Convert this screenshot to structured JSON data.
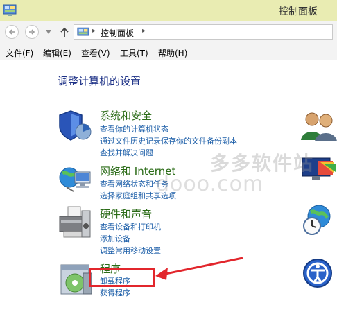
{
  "window": {
    "title": "控制面板"
  },
  "address": {
    "path_label": "控制面板",
    "sep1": "▸",
    "sep2": "▸"
  },
  "menu": {
    "items": [
      "文件(F)",
      "编辑(E)",
      "查看(V)",
      "工具(T)",
      "帮助(H)"
    ]
  },
  "main": {
    "heading": "调整计算机的设置",
    "categories": [
      {
        "title": "系统和安全",
        "links": [
          "查看你的计算机状态",
          "通过文件历史记录保存你的文件备份副本",
          "查找并解决问题"
        ]
      },
      {
        "title": "网络和 Internet",
        "links": [
          "查看网络状态和任务",
          "选择家庭组和共享选项"
        ]
      },
      {
        "title": "硬件和声音",
        "links": [
          "查看设备和打印机",
          "添加设备",
          "调整常用移动设置"
        ]
      },
      {
        "title": "程序",
        "links": [
          "卸载程序",
          "获得程序"
        ]
      }
    ]
  },
  "watermark": {
    "cn": "多多软件站",
    "en": "dooo.com"
  },
  "colors": {
    "title_bg": "#e9ecb2",
    "category_title": "#2a6b16",
    "link": "#1c5ea8",
    "heading": "#1e3287",
    "annotation": "#e2262c"
  },
  "icons": {
    "app": "control-panel-icon",
    "back": "back-arrow-icon",
    "forward": "forward-arrow-icon",
    "up": "up-arrow-icon",
    "system": "shield-icon",
    "network": "globe-network-icon",
    "hardware": "printer-icon",
    "programs": "program-disc-icon",
    "users": "users-icon",
    "appearance": "appearance-icon",
    "clock": "clock-globe-icon",
    "ease": "ease-of-access-icon"
  }
}
